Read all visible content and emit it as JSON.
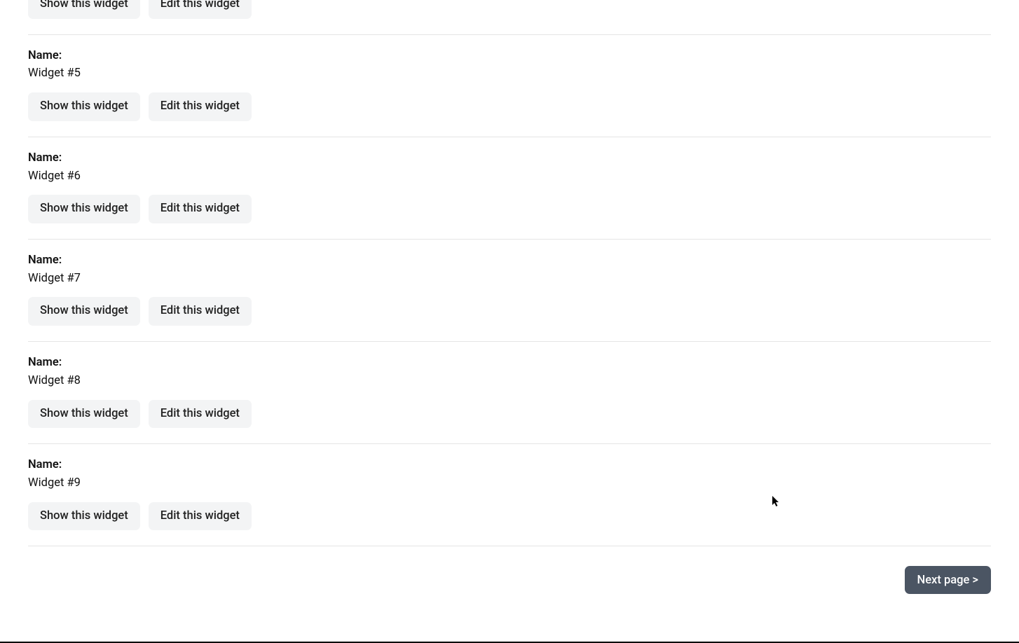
{
  "labels": {
    "name": "Name:",
    "show": "Show this widget",
    "edit": "Edit this widget",
    "next": "Next page >"
  },
  "widgets": [
    {
      "name": ""
    },
    {
      "name": "Widget #5"
    },
    {
      "name": "Widget #6"
    },
    {
      "name": "Widget #7"
    },
    {
      "name": "Widget #8"
    },
    {
      "name": "Widget #9"
    }
  ]
}
